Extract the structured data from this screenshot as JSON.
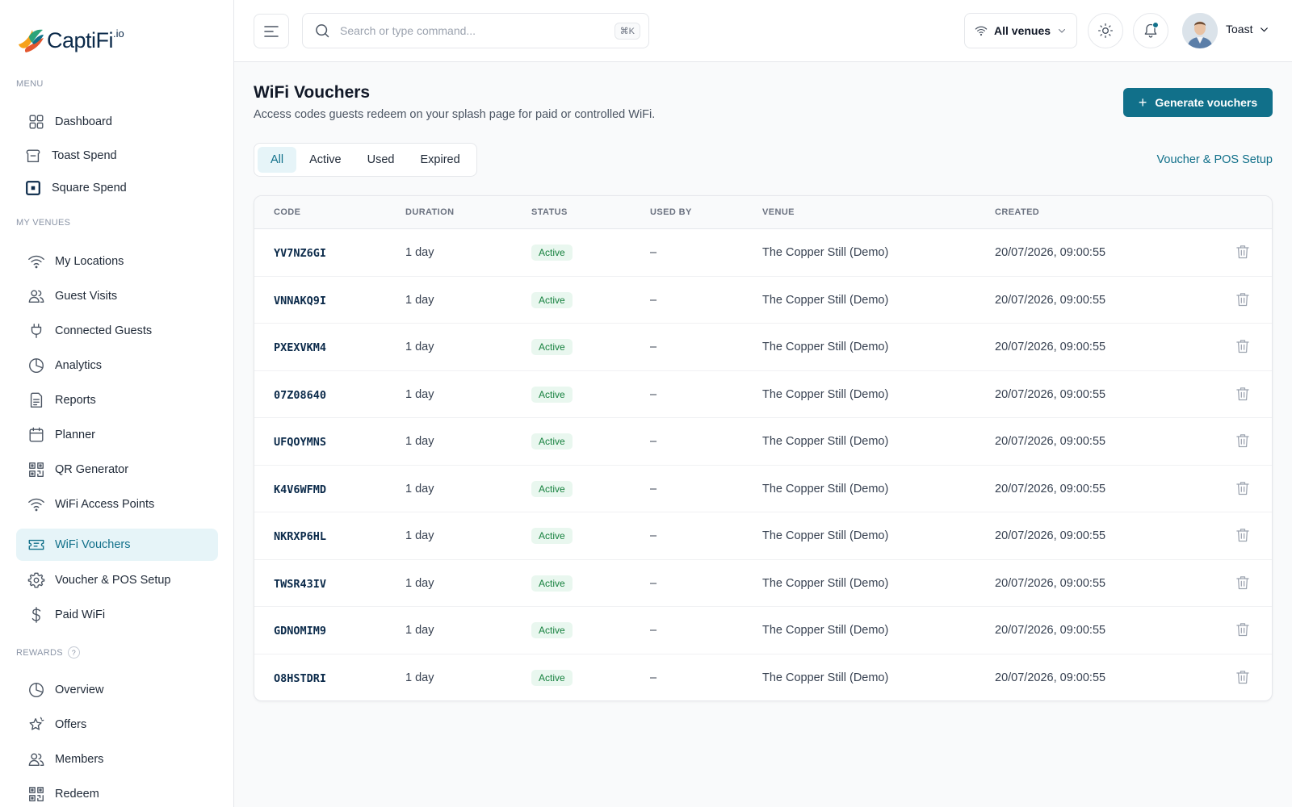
{
  "brand": {
    "name": "CaptiFi",
    "suffix": ".io",
    "accent": "#11708a"
  },
  "sidebar": {
    "sections": [
      {
        "label": "MENU",
        "items": [
          {
            "label": "Dashboard",
            "icon": "grid-icon"
          },
          {
            "label": "Toast Spend",
            "icon": "toast-icon"
          },
          {
            "label": "Square Spend",
            "icon": "square-icon"
          }
        ]
      },
      {
        "label": "MY VENUES",
        "items": [
          {
            "label": "My Locations",
            "icon": "wifi-icon"
          },
          {
            "label": "Guest Visits",
            "icon": "users-icon"
          },
          {
            "label": "Connected Guests",
            "icon": "plug-icon"
          },
          {
            "label": "Analytics",
            "icon": "pie-chart-icon"
          },
          {
            "label": "Reports",
            "icon": "document-icon"
          },
          {
            "label": "Planner",
            "icon": "calendar-icon"
          },
          {
            "label": "QR Generator",
            "icon": "qr-code-icon"
          },
          {
            "label": "WiFi Access Points",
            "icon": "wifi-icon"
          },
          {
            "label": "WiFi Vouchers",
            "icon": "ticket-icon",
            "active": true
          },
          {
            "label": "Voucher & POS Setup",
            "icon": "gear-icon"
          },
          {
            "label": "Paid WiFi",
            "icon": "dollar-icon"
          }
        ]
      },
      {
        "label": "REWARDS",
        "help": "?",
        "items": [
          {
            "label": "Overview",
            "icon": "pie-chart-icon"
          },
          {
            "label": "Offers",
            "icon": "star-icon"
          },
          {
            "label": "Members",
            "icon": "users-icon"
          },
          {
            "label": "Redeem",
            "icon": "qr-code-icon"
          }
        ]
      }
    ]
  },
  "topbar": {
    "search_placeholder": "Search or type command...",
    "search_shortcut": "⌘K",
    "venue_select": "All venues",
    "user_name": "Toast"
  },
  "page": {
    "title": "WiFi Vouchers",
    "subtitle": "Access codes guests redeem on your splash page for paid or controlled WiFi.",
    "generate_button": "Generate vouchers",
    "setup_link": "Voucher & POS Setup",
    "tabs": [
      "All",
      "Active",
      "Used",
      "Expired"
    ],
    "active_tab": "All"
  },
  "table": {
    "columns": [
      "CODE",
      "DURATION",
      "STATUS",
      "USED BY",
      "VENUE",
      "CREATED"
    ],
    "rows": [
      {
        "code": "YV7NZ6GI",
        "duration": "1 day",
        "status": "Active",
        "used_by": "–",
        "venue": "The Copper Still (Demo)",
        "created": "20/07/2026, 09:00:55"
      },
      {
        "code": "VNNAKQ9I",
        "duration": "1 day",
        "status": "Active",
        "used_by": "–",
        "venue": "The Copper Still (Demo)",
        "created": "20/07/2026, 09:00:55"
      },
      {
        "code": "PXEXVKM4",
        "duration": "1 day",
        "status": "Active",
        "used_by": "–",
        "venue": "The Copper Still (Demo)",
        "created": "20/07/2026, 09:00:55"
      },
      {
        "code": "07Z08640",
        "duration": "1 day",
        "status": "Active",
        "used_by": "–",
        "venue": "The Copper Still (Demo)",
        "created": "20/07/2026, 09:00:55"
      },
      {
        "code": "UFQOYMNS",
        "duration": "1 day",
        "status": "Active",
        "used_by": "–",
        "venue": "The Copper Still (Demo)",
        "created": "20/07/2026, 09:00:55"
      },
      {
        "code": "K4V6WFMD",
        "duration": "1 day",
        "status": "Active",
        "used_by": "–",
        "venue": "The Copper Still (Demo)",
        "created": "20/07/2026, 09:00:55"
      },
      {
        "code": "NKRXP6HL",
        "duration": "1 day",
        "status": "Active",
        "used_by": "–",
        "venue": "The Copper Still (Demo)",
        "created": "20/07/2026, 09:00:55"
      },
      {
        "code": "TWSR43IV",
        "duration": "1 day",
        "status": "Active",
        "used_by": "–",
        "venue": "The Copper Still (Demo)",
        "created": "20/07/2026, 09:00:55"
      },
      {
        "code": "GDNOMIM9",
        "duration": "1 day",
        "status": "Active",
        "used_by": "–",
        "venue": "The Copper Still (Demo)",
        "created": "20/07/2026, 09:00:55"
      },
      {
        "code": "O8HSTDRI",
        "duration": "1 day",
        "status": "Active",
        "used_by": "–",
        "venue": "The Copper Still (Demo)",
        "created": "20/07/2026, 09:00:55"
      }
    ]
  }
}
